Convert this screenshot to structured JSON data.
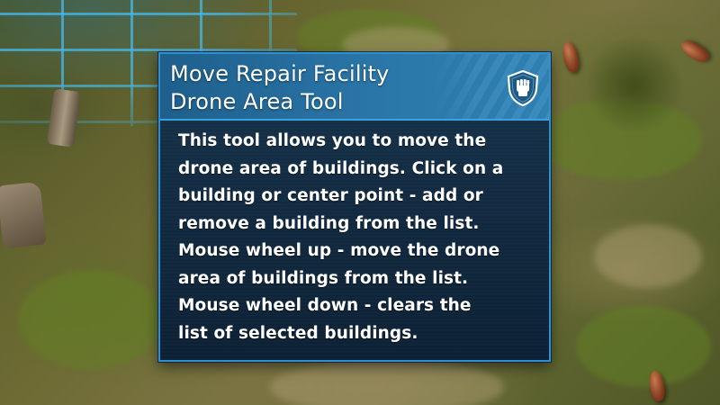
{
  "tooltip": {
    "title_lines": [
      "Move Repair Facility",
      "Drone Area Tool"
    ],
    "icon": "shield-fist-icon",
    "description_lines": [
      "This tool allows you to move the",
      "drone area of buildings. Click on a",
      "building or center point - add or",
      "remove a building from the list.",
      "Mouse wheel up - move the drone",
      "area of buildings from the list.",
      "Mouse wheel down - clears the",
      "list of selected buildings."
    ]
  },
  "colors": {
    "panel_border": "#2f8fd0",
    "header_bg": "#2a76a8",
    "body_bg": "#14304a",
    "text": "#ffffff"
  }
}
